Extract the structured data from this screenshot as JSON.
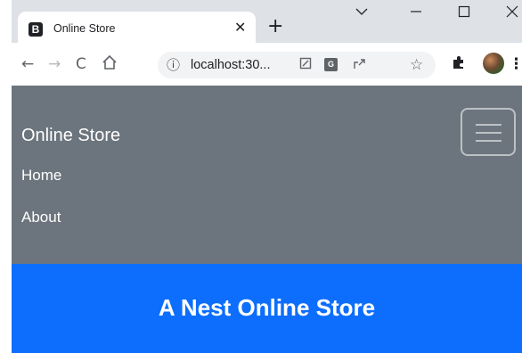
{
  "browser": {
    "tab_title": "Online Store",
    "favicon_letter": "B",
    "address": "localhost:30...",
    "translate_badge": "G"
  },
  "page": {
    "brand": "Online Store",
    "nav_links": [
      "Home",
      "About"
    ],
    "hero_title": "A Nest Online Store"
  },
  "colors": {
    "navbar_bg": "#6c757d",
    "hero_bg": "#0d6efd",
    "tabstrip_bg": "#dee1e6"
  },
  "icons": [
    "close-icon",
    "plus-icon",
    "back-arrow-icon",
    "forward-arrow-icon",
    "reload-icon",
    "home-icon",
    "info-icon",
    "open-in-app-icon",
    "translate-icon",
    "share-icon",
    "star-icon",
    "extensions-icon",
    "menu-kebab-icon",
    "hamburger-icon"
  ]
}
